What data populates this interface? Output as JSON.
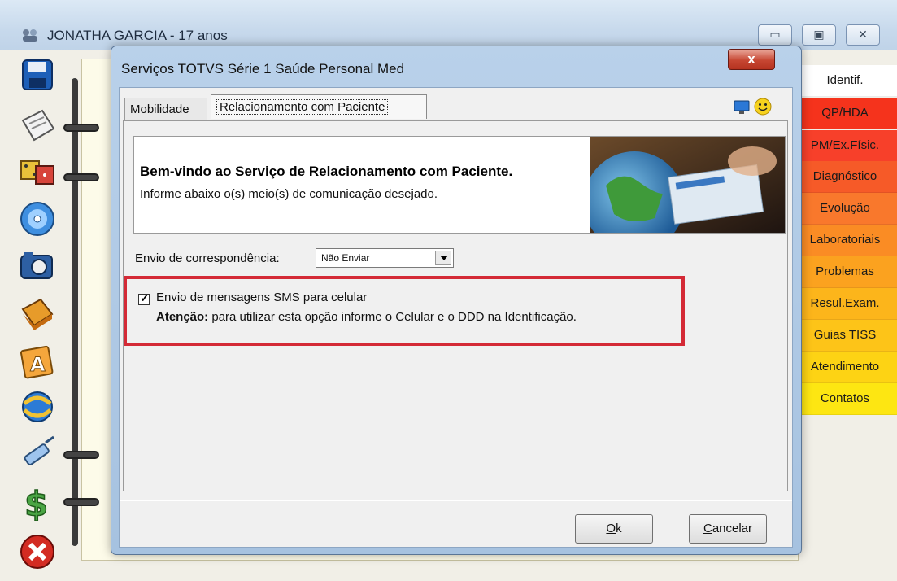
{
  "main_window": {
    "title": "JONATHA GARCIA - 17 anos",
    "buttons": {
      "minimize": "▭",
      "maximize": "▣",
      "close": "✕"
    }
  },
  "sidebar": {
    "icons": [
      "save-disk-icon",
      "notepad-icon",
      "dice-icon",
      "cd-disc-icon",
      "camera-icon",
      "books-icon",
      "letter-a-icon",
      "exchange-globe-icon",
      "syringe-icon",
      "dollar-icon",
      "exit-x-icon"
    ]
  },
  "side_tabs": [
    {
      "label": "Identif.",
      "color": "#ffffff"
    },
    {
      "label": "QP/HDA",
      "color": "#f5331c"
    },
    {
      "label": "PM/Ex.Físic.",
      "color": "#f7402a"
    },
    {
      "label": "Diagnóstico",
      "color": "#f65a28"
    },
    {
      "label": "Evolução",
      "color": "#f9782c"
    },
    {
      "label": "Laboratoriais",
      "color": "#fa8c24"
    },
    {
      "label": "Problemas",
      "color": "#fba21f"
    },
    {
      "label": "Resul.Exam.",
      "color": "#fcb51b"
    },
    {
      "label": "Guias TISS",
      "color": "#fdc418"
    },
    {
      "label": "Atendimento",
      "color": "#fdd314"
    },
    {
      "label": "Contatos",
      "color": "#fde612"
    }
  ],
  "dialog": {
    "title": "Serviços TOTVS Série 1 Saúde Personal Med",
    "close_label": "x",
    "tabs": [
      "Mobilidade",
      "Relacionamento com Paciente"
    ],
    "banner": {
      "heading": "Bem-vindo ao Serviço de Relacionamento com Paciente.",
      "subtext": "Informe abaixo o(s) meio(s) de comunicação desejado."
    },
    "correspondence": {
      "label": "Envio de correspondência:",
      "selected": "Não Enviar"
    },
    "sms": {
      "checked": true,
      "check_mark": "✓",
      "label": "Envio de mensagens SMS para celular",
      "warning_title": "Atenção:",
      "warning_text": " para utilizar esta opção informe o Celular e o DDD na Identificação."
    },
    "buttons": {
      "ok": "Ok",
      "cancel": "Cancelar"
    }
  },
  "colors": {
    "highlight_border": "#d42a36",
    "dialog_frame": "#b9d1ea"
  }
}
